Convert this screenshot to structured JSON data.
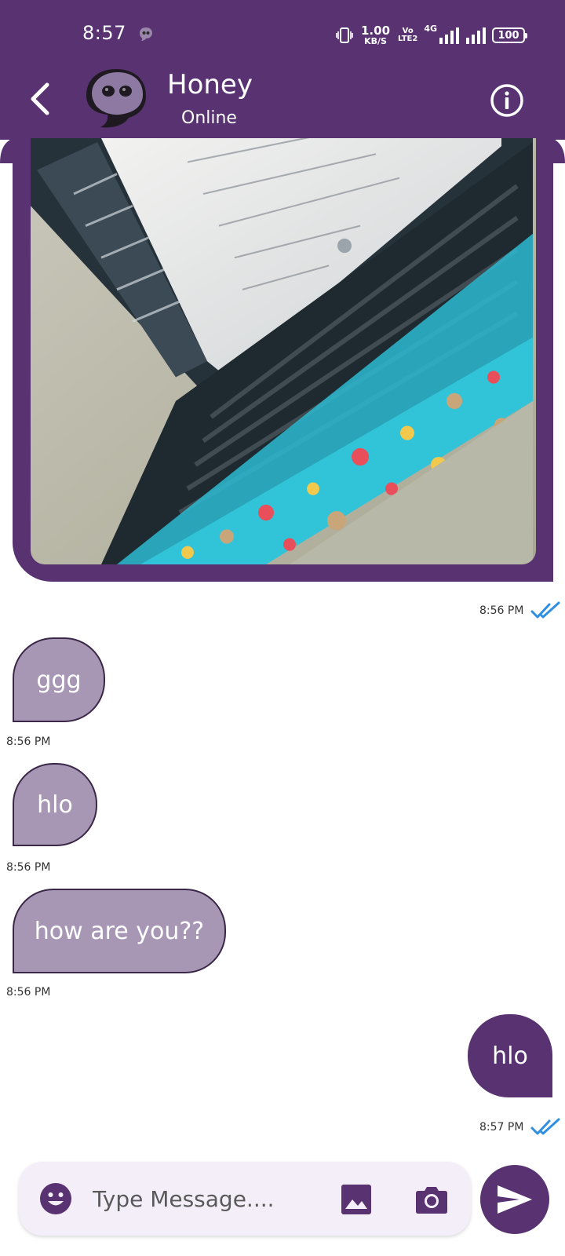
{
  "status_bar": {
    "time": "8:57",
    "net_speed_value": "1.00",
    "net_speed_unit": "KB/S",
    "volte_top": "Vo",
    "volte_bottom": "LTE2",
    "network": "4G",
    "battery": "100"
  },
  "header": {
    "contact_name": "Honey",
    "contact_status": "Online"
  },
  "messages": [
    {
      "type": "image",
      "direction": "out",
      "time": "8:56 PM"
    },
    {
      "type": "text",
      "direction": "in",
      "text": "ggg",
      "time": "8:56 PM"
    },
    {
      "type": "text",
      "direction": "in",
      "text": "hlo",
      "time": "8:56 PM"
    },
    {
      "type": "text",
      "direction": "in",
      "text": "how are you??",
      "time": "8:56 PM"
    },
    {
      "type": "text",
      "direction": "out",
      "text": "hlo",
      "time": "8:57 PM"
    }
  ],
  "composer": {
    "placeholder": "Type Message...."
  },
  "icons": {
    "back": "back-arrow-icon",
    "info": "info-icon",
    "emoji": "emoji-icon",
    "gallery": "image-icon",
    "camera": "camera-icon",
    "send": "send-icon",
    "read": "double-check-icon"
  },
  "colors": {
    "primary": "#583271",
    "incoming_bubble": "#a797b4",
    "composer_bg": "#f4eef9",
    "read_ticks": "#2f8fe0"
  }
}
